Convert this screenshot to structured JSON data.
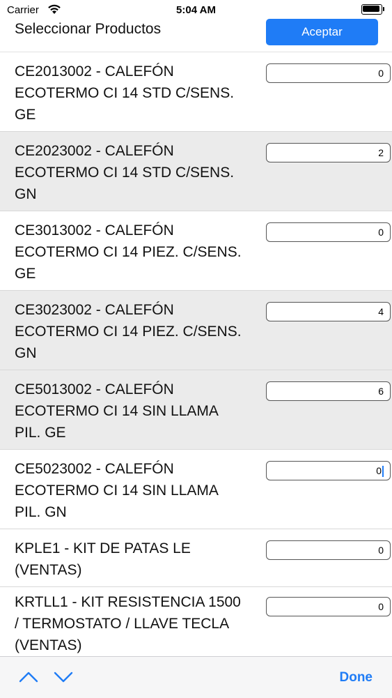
{
  "status_bar": {
    "carrier": "Carrier",
    "time": "5:04 AM"
  },
  "header": {
    "title": "Seleccionar Productos",
    "accept_label": "Aceptar"
  },
  "products": [
    {
      "lines": [
        "CE2013002 - CALEFÓN",
        "ECOTERMO CI 14 STD C/SENS.",
        "GE"
      ],
      "qty": "0"
    },
    {
      "lines": [
        "CE2023002 - CALEFÓN",
        "ECOTERMO CI 14 STD C/SENS.",
        "GN"
      ],
      "qty": "2"
    },
    {
      "lines": [
        "CE3013002 - CALEFÓN",
        "ECOTERMO CI 14 PIEZ. C/SENS.",
        "GE"
      ],
      "qty": "0"
    },
    {
      "lines": [
        "CE3023002 - CALEFÓN",
        "ECOTERMO CI 14 PIEZ. C/SENS.",
        "GN"
      ],
      "qty": "4"
    },
    {
      "lines": [
        "CE5013002 - CALEFÓN",
        "ECOTERMO CI 14 SIN LLAMA",
        "PIL. GE"
      ],
      "qty": "6"
    },
    {
      "lines": [
        "CE5023002 - CALEFÓN",
        "ECOTERMO CI 14 SIN LLAMA",
        "PIL. GN"
      ],
      "qty": "0"
    },
    {
      "lines": [
        "KPLE1 - KIT DE PATAS LE",
        "(VENTAS)"
      ],
      "qty": "0"
    },
    {
      "lines": [
        "KRTLL1 - KIT RESISTENCIA 1500",
        "/ TERMOSTATO / LLAVE TECLA",
        "(VENTAS)"
      ],
      "qty": "0"
    }
  ],
  "toolbar": {
    "done_label": "Done",
    "accent": "#1f7cf6"
  }
}
